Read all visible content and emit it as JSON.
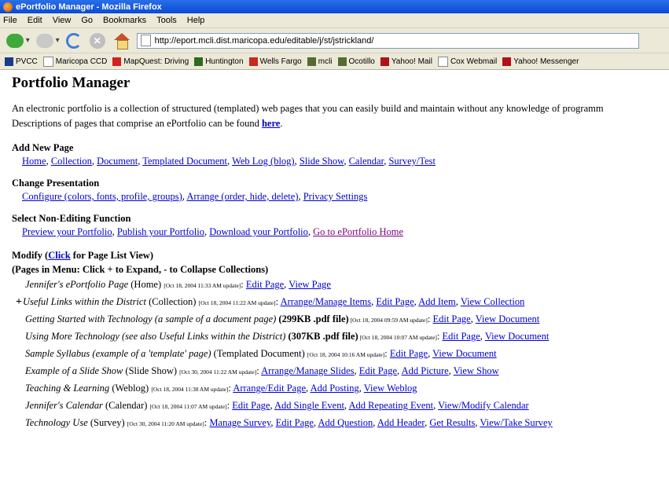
{
  "window": {
    "title": "ePortfolio Manager - Mozilla Firefox"
  },
  "menu": [
    "File",
    "Edit",
    "View",
    "Go",
    "Bookmarks",
    "Tools",
    "Help"
  ],
  "address": {
    "url": "http://eport.mcli.dist.maricopa.edu/editable/j/st/jstrickland/"
  },
  "bookmarks": [
    {
      "label": "PVCC",
      "icon": "arch-icon",
      "color": "#1a3c8a"
    },
    {
      "label": "Maricopa CCD",
      "icon": "page-icon",
      "color": "#ffffff"
    },
    {
      "label": "MapQuest: Driving",
      "icon": "mapquest-icon",
      "color": "#d62020"
    },
    {
      "label": "Huntington",
      "icon": "huntington-icon",
      "color": "#2f6b1e"
    },
    {
      "label": "Wells Fargo",
      "icon": "wellsfargo-icon",
      "color": "#c8281e"
    },
    {
      "label": "mcli",
      "icon": "mcli-icon",
      "color": "#556b2f"
    },
    {
      "label": "Ocotillo",
      "icon": "ocotillo-icon",
      "color": "#556b2f"
    },
    {
      "label": "Yahoo! Mail",
      "icon": "yahoo-icon",
      "color": "#b3101a"
    },
    {
      "label": "Cox Webmail",
      "icon": "page-icon",
      "color": "#ffffff"
    },
    {
      "label": "Yahoo! Messenger",
      "icon": "yahoo-icon",
      "color": "#b3101a"
    }
  ],
  "page": {
    "title": "Portfolio Manager",
    "intro_line1": "An electronic portfolio is a collection of structured (templated) web pages that you can easily build and maintain without any knowledge of programm",
    "intro_line2": "Descriptions of pages that comprise an ePortfolio can be found ",
    "intro_link": "here",
    "intro_end": ".",
    "sections": [
      {
        "heading": "Add New Page",
        "links": [
          "Home",
          "Collection",
          "Document",
          "Templated Document",
          "Web Log (blog)",
          "Slide Show",
          "Calendar",
          "Survey/Test"
        ]
      },
      {
        "heading": "Change Presentation",
        "links": [
          "Configure (colors, fonts, profile, groups)",
          "Arrange (order, hide, delete)",
          "Privacy Settings"
        ]
      },
      {
        "heading": "Select Non-Editing Function",
        "links": [
          "Preview your Portfolio",
          "Publish your Portfolio",
          "Download your Portfolio",
          "Go to ePortfolio Home"
        ]
      }
    ],
    "modify": {
      "heading_prefix": "Modify (",
      "heading_link": "Click",
      "heading_suffix": " for Page List View)",
      "subheading": "(Pages in Menu: Click + to Expand, - to Collapse Collections)"
    },
    "pages": [
      {
        "title": "Jennifer's ePortfolio Page",
        "type": " (Home) ",
        "extra": "",
        "updated": "[Oct 18, 2004 11:33 AM update]",
        "actions": [
          "Edit Page",
          "View Page"
        ],
        "expand": ""
      },
      {
        "title": "Useful Links within the District",
        "type": " (Collection) ",
        "extra": "",
        "updated": "[Oct 18, 2004 11:22 AM update]",
        "actions": [
          "Arrange/Manage Items",
          "Edit Page",
          "Add Item",
          "View Collection"
        ],
        "expand": "+"
      },
      {
        "title": "Getting Started with Technology (a sample of a document page)",
        "type": " ",
        "extra": "(299KB .pdf file)",
        "updated": " [Oct 18, 2004 09:59 AM update]",
        "actions": [
          "Edit Page",
          "View Document"
        ],
        "expand": ""
      },
      {
        "title": "Using More Technology (see also Useful Links within the District)",
        "type": " ",
        "extra": "(307KB .pdf file)",
        "updated": " [Oct 18, 2004 10:07 AM update]",
        "actions": [
          "Edit Page",
          "View Document"
        ],
        "expand": ""
      },
      {
        "title": "Sample Syllabus (example of a 'template' page)",
        "type": " (Templated Document) ",
        "extra": "",
        "updated": "[Oct 18, 2004 10:16 AM update]",
        "actions": [
          "Edit Page",
          "View Document"
        ],
        "expand": ""
      },
      {
        "title": "Example of a Slide Show",
        "type": " (Slide Show) ",
        "extra": "",
        "updated": "[Oct 30, 2004 11:22 AM update]",
        "actions": [
          "Arrange/Manage Slides",
          "Edit Page",
          "Add Picture",
          "View Show"
        ],
        "expand": ""
      },
      {
        "title": "Teaching & Learning",
        "type": " (Weblog) ",
        "extra": "",
        "updated": "[Oct 18, 2004 11:38 AM update]",
        "actions": [
          "Arrange/Edit Page",
          "Add Posting",
          "View Weblog"
        ],
        "expand": ""
      },
      {
        "title": "Jennifer's Calendar",
        "type": " (Calendar) ",
        "extra": "",
        "updated": "[Oct 18, 2004 11:07 AM update]",
        "actions": [
          "Edit Page",
          "Add Single Event",
          "Add Repeating Event",
          "View/Modify Calendar"
        ],
        "expand": ""
      },
      {
        "title": "Technology Use",
        "type": " (Survey) ",
        "extra": "",
        "updated": "[Oct 30, 2004 11:20 AM update]",
        "actions": [
          "Manage Survey",
          "Edit Page",
          "Add Question",
          "Add Header",
          "Get Results",
          "View/Take Survey"
        ],
        "expand": ""
      }
    ]
  }
}
